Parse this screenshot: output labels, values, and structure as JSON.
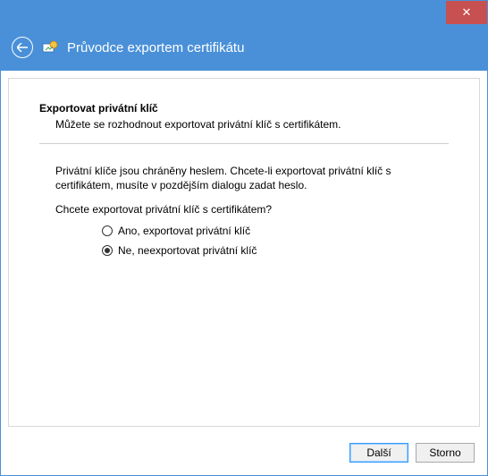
{
  "header": {
    "title": "Průvodce exportem certifikátu"
  },
  "section": {
    "title": "Exportovat privátní klíč",
    "desc": "Můžete se rozhodnout exportovat privátní klíč s certifikátem."
  },
  "body": {
    "info": "Privátní klíče jsou chráněny heslem. Chcete-li exportovat privátní klíč s certifikátem, musíte v pozdějším dialogu zadat heslo.",
    "question": "Chcete exportovat privátní klíč s certifikátem?"
  },
  "options": {
    "yes": "Ano, exportovat privátní klíč",
    "no": "Ne, neexportovat privátní klíč",
    "selected": "no"
  },
  "footer": {
    "next": "Další",
    "cancel": "Storno"
  },
  "close_label": "✕"
}
